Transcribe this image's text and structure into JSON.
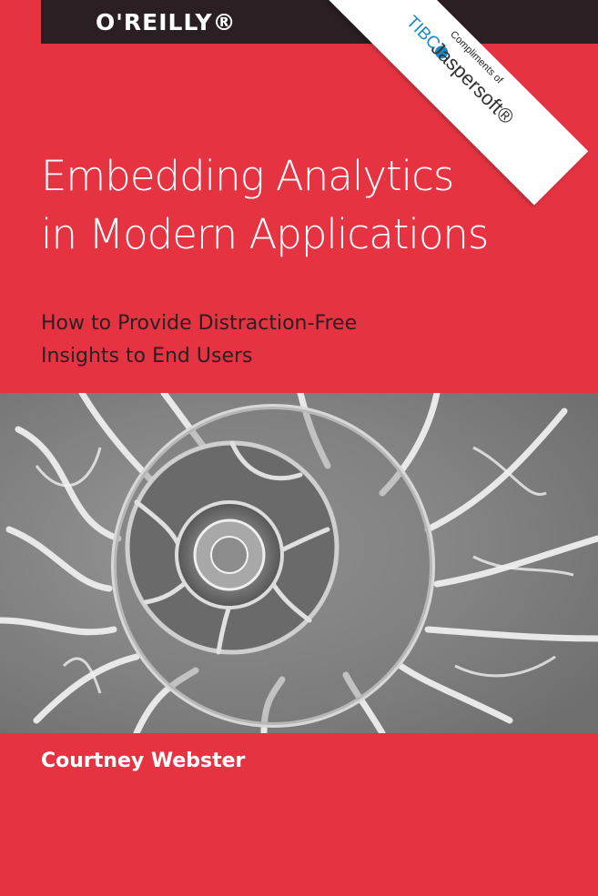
{
  "cover": {
    "publisher": "O'REILLY®",
    "sponsor": {
      "compliments": "Compliments of",
      "brand_tibco": "TIBC",
      "brand_jaspersoft": "Jaspersoft®"
    },
    "title_line1": "Embedding Analytics",
    "title_line2": "in Modern Applications",
    "subtitle_line1": "How to Provide Distraction-Free",
    "subtitle_line2": "Insights to End Users",
    "author": "Courtney Webster",
    "image_icon": "ammonite-fossil-photo"
  },
  "colors": {
    "background": "#e53342",
    "top_bar": "#2a1f22",
    "title_text": "#ffffff",
    "subtitle_text": "#2a1f22",
    "tibco_blue": "#1a8ac6"
  }
}
